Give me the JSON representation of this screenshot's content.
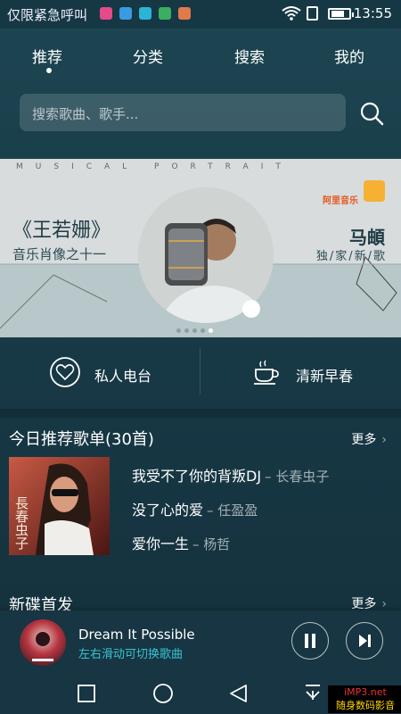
{
  "status_bar": {
    "left_text": "仅限紧急呼叫",
    "time": "13:55",
    "app_icons": [
      {
        "name": "music-app-icon",
        "color": "#e54a8a"
      },
      {
        "name": "messaging-app-icon",
        "color": "#3a9be0"
      },
      {
        "name": "notes-app-icon",
        "color": "#2ab4d8"
      },
      {
        "name": "gallery-app-icon",
        "color": "#3cae62"
      },
      {
        "name": "weibo-app-icon",
        "color": "#e07a4a"
      }
    ]
  },
  "tabs": [
    {
      "label": "推荐",
      "active": true
    },
    {
      "label": "分类",
      "active": false
    },
    {
      "label": "搜索",
      "active": false
    },
    {
      "label": "我的",
      "active": false
    }
  ],
  "search": {
    "placeholder": "搜索歌曲、歌手..."
  },
  "banner": {
    "deco_text": "MUSICAL PORTRAIT",
    "title": "《王若姗》",
    "subtitle": "音乐肖像之十一",
    "artist": "马頔",
    "exclusive": "独/家/新/歌",
    "logo_text": "阿里音乐",
    "page_count": 5,
    "active_page": 4
  },
  "quick_actions": [
    {
      "label": "私人电台",
      "icon": "heart-icon"
    },
    {
      "label": "清新早春",
      "icon": "coffee-cup-icon"
    }
  ],
  "recommend": {
    "title": "今日推荐歌单(30首)",
    "more": "更多",
    "cover_text": "長春虫子",
    "songs": [
      {
        "title": "我受不了你的背叛DJ",
        "artist": "– 长春虫子"
      },
      {
        "title": "没了心的爱",
        "artist": "– 任盈盈"
      },
      {
        "title": "爱你一生",
        "artist": "– 杨哲"
      }
    ]
  },
  "new_releases": {
    "title": "新碟首发",
    "more": "更多"
  },
  "player": {
    "title": "Dream It Possible",
    "subtitle": "左右滑动可切换歌曲"
  },
  "watermark": {
    "line1": "iMP3.net",
    "line2": "随身数码影音"
  }
}
